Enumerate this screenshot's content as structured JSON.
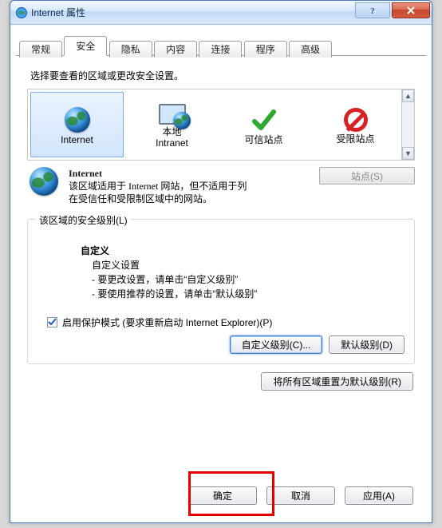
{
  "window": {
    "title": "Internet 属性"
  },
  "tabs": {
    "general": "常规",
    "security": "安全",
    "privacy": "隐私",
    "content": "内容",
    "connections": "连接",
    "programs": "程序",
    "advanced": "高级"
  },
  "zone_prompt": "选择要查看的区域或更改安全设置。",
  "zones": {
    "internet": "Internet",
    "intranet_l1": "本地",
    "intranet_l2": "Intranet",
    "trusted": "可信站点",
    "restricted": "受限站点"
  },
  "zone_desc": {
    "header": "Internet",
    "body": "该区域适用于 Internet 网站，但不适用于列在受信任和受限制区域中的网站。"
  },
  "sites_button": "站点(S)",
  "group_title": "该区域的安全级别(L)",
  "level": {
    "name": "自定义",
    "line1": "自定义设置",
    "line2": "- 要更改设置，请单击“自定义级别”",
    "line3": "- 要使用推荐的设置，请单击“默认级别”"
  },
  "protected_mode": "启用保护模式 (要求重新启动 Internet Explorer)(P)",
  "buttons": {
    "custom_level": "自定义级别(C)...",
    "default_level": "默认级别(D)",
    "reset_all": "将所有区域重置为默认级别(R)",
    "ok": "确定",
    "cancel": "取消",
    "apply": "应用(A)"
  }
}
